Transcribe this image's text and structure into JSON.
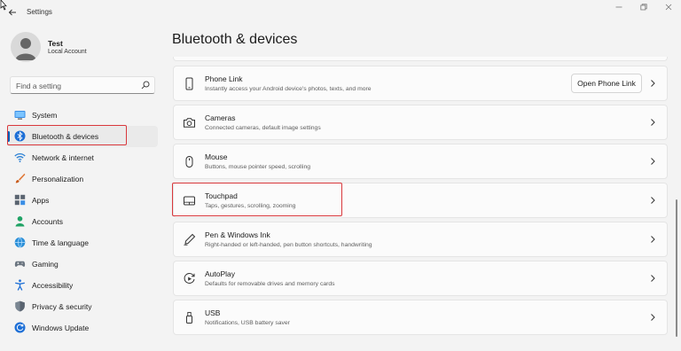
{
  "window": {
    "app_title": "Settings",
    "controls": [
      "minimize",
      "maximize",
      "close"
    ]
  },
  "profile": {
    "name": "Test",
    "account_type": "Local Account"
  },
  "search": {
    "placeholder": "Find a setting"
  },
  "sidebar": {
    "items": [
      {
        "label": "System",
        "icon": "monitor-icon"
      },
      {
        "label": "Bluetooth & devices",
        "icon": "bluetooth-icon",
        "active": true
      },
      {
        "label": "Network & internet",
        "icon": "wifi-icon"
      },
      {
        "label": "Personalization",
        "icon": "brush-icon"
      },
      {
        "label": "Apps",
        "icon": "apps-icon"
      },
      {
        "label": "Accounts",
        "icon": "person-icon"
      },
      {
        "label": "Time & language",
        "icon": "globe-clock-icon"
      },
      {
        "label": "Gaming",
        "icon": "gamepad-icon"
      },
      {
        "label": "Accessibility",
        "icon": "accessibility-icon"
      },
      {
        "label": "Privacy & security",
        "icon": "shield-icon"
      },
      {
        "label": "Windows Update",
        "icon": "update-icon"
      }
    ]
  },
  "main": {
    "title": "Bluetooth & devices",
    "cards": [
      {
        "title": "Phone Link",
        "desc": "Instantly access your Android device's photos, texts, and more",
        "icon": "phone-icon",
        "button": "Open Phone Link"
      },
      {
        "title": "Cameras",
        "desc": "Connected cameras, default image settings",
        "icon": "camera-icon"
      },
      {
        "title": "Mouse",
        "desc": "Buttons, mouse pointer speed, scrolling",
        "icon": "mouse-icon"
      },
      {
        "title": "Touchpad",
        "desc": "Taps, gestures, scrolling, zooming",
        "icon": "touchpad-icon"
      },
      {
        "title": "Pen & Windows Ink",
        "desc": "Right-handed or left-handed, pen button shortcuts, handwriting",
        "icon": "pen-icon"
      },
      {
        "title": "AutoPlay",
        "desc": "Defaults for removable drives and memory cards",
        "icon": "autoplay-icon"
      },
      {
        "title": "USB",
        "desc": "Notifications, USB battery saver",
        "icon": "usb-icon"
      }
    ]
  },
  "colors": {
    "accent": "#005fb8",
    "highlight": "#d9383c",
    "background": "#f3f3f3",
    "card": "#fbfbfb"
  }
}
